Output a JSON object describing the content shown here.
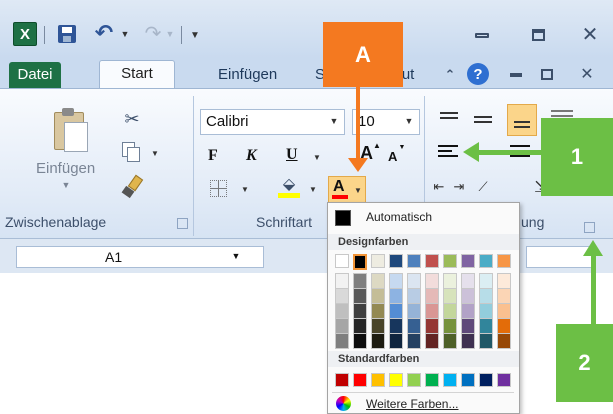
{
  "window": {
    "logo_letter": "X",
    "title_buttons": [
      "minimize",
      "restore",
      "close"
    ]
  },
  "tabs": [
    {
      "label": "Datei",
      "active": false
    },
    {
      "label": "Start",
      "active": true
    },
    {
      "label": "Einfügen",
      "active": false
    },
    {
      "label": "S",
      "active": false
    },
    {
      "label": "yout",
      "active": false
    }
  ],
  "clipboard": {
    "paste_label": "Einfügen",
    "group_label": "Zwischenablage"
  },
  "font": {
    "name": "Calibri",
    "size": "10",
    "bold": "F",
    "italic": "K",
    "underline": "U",
    "grow": "A",
    "shrink": "A",
    "group_label": "Schriftart"
  },
  "alignment": {
    "group_label": "ung"
  },
  "formula": {
    "name_box": "A1"
  },
  "palette": {
    "automatic_label": "Automatisch",
    "design_label": "Designfarben",
    "standard_label": "Standardfarben",
    "more_label": "Weitere Farben...",
    "theme_top": [
      "#ffffff",
      "#000000",
      "#eeece1",
      "#1f497d",
      "#4f81bd",
      "#c0504d",
      "#9bbb59",
      "#8064a2",
      "#4bacc6",
      "#f79646"
    ],
    "theme_cols": [
      [
        "#f2f2f2",
        "#d9d9d9",
        "#bfbfbf",
        "#a6a6a6",
        "#7f7f7f"
      ],
      [
        "#7f7f7f",
        "#595959",
        "#3f3f3f",
        "#262626",
        "#0c0c0c"
      ],
      [
        "#ddd9c3",
        "#c4bd97",
        "#938953",
        "#494429",
        "#1d1b10"
      ],
      [
        "#c6d9f0",
        "#8db3e2",
        "#548dd4",
        "#17365d",
        "#0f243e"
      ],
      [
        "#dbe5f1",
        "#b8cce4",
        "#95b3d7",
        "#366092",
        "#244061"
      ],
      [
        "#f2dcdb",
        "#e5b9b7",
        "#d99694",
        "#953734",
        "#632423"
      ],
      [
        "#ebf1dd",
        "#d7e3bc",
        "#c3d69b",
        "#76923c",
        "#4f6128"
      ],
      [
        "#e5e0ec",
        "#ccc1d9",
        "#b2a2c7",
        "#5f497a",
        "#3f3151"
      ],
      [
        "#dbeef3",
        "#b7dde8",
        "#92cddc",
        "#31859b",
        "#205867"
      ],
      [
        "#fdeada",
        "#fbd5b5",
        "#fac08f",
        "#e36c09",
        "#974806"
      ]
    ],
    "standard": [
      "#c00000",
      "#ff0000",
      "#ffc000",
      "#ffff00",
      "#92d050",
      "#00b050",
      "#00b0f0",
      "#0070c0",
      "#002060",
      "#7030a0"
    ]
  },
  "callouts": {
    "a": "A",
    "one": "1",
    "two": "2"
  },
  "colors": {
    "accent_orange": "#f47920",
    "callout_green": "#6cbf45",
    "file_tab": "#1e7145"
  }
}
